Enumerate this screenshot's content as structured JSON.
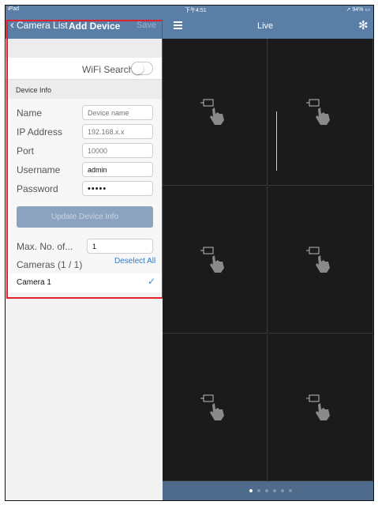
{
  "status_bar": {
    "left": "iPad",
    "time": "下午4:51",
    "right": "94%"
  },
  "left_nav": {
    "back_label": "Camera List",
    "title": "Add Device",
    "save_label": "Save"
  },
  "wifi_search": {
    "label": "WiFi Search",
    "enabled": false
  },
  "device_info": {
    "section_label": "Device Info",
    "fields": [
      {
        "label": "Name",
        "value": "",
        "placeholder": "Device name"
      },
      {
        "label": "IP Address",
        "value": "",
        "placeholder": "192.168.x.x"
      },
      {
        "label": "Port",
        "value": "",
        "placeholder": "10000"
      },
      {
        "label": "Username",
        "value": "admin",
        "placeholder": ""
      },
      {
        "label": "Password",
        "value": "•••••",
        "placeholder": ""
      }
    ],
    "update_button": "Update Device Info",
    "max_no_label": "Max. No. of...",
    "max_no_value": "1",
    "cameras_label": "Cameras (1 / 1)",
    "deselect_all": "Deselect All",
    "camera_items": [
      {
        "label": "Camera 1",
        "checked": true
      }
    ]
  },
  "right_nav": {
    "title": "Live"
  },
  "live_grid": {
    "rows": 3,
    "cols": 2,
    "page_dots": 6,
    "active_dot": 0
  },
  "colors": {
    "nav_bar": "#5b7ea6",
    "accent": "#2f7ad0",
    "highlight": "#e0202a"
  }
}
